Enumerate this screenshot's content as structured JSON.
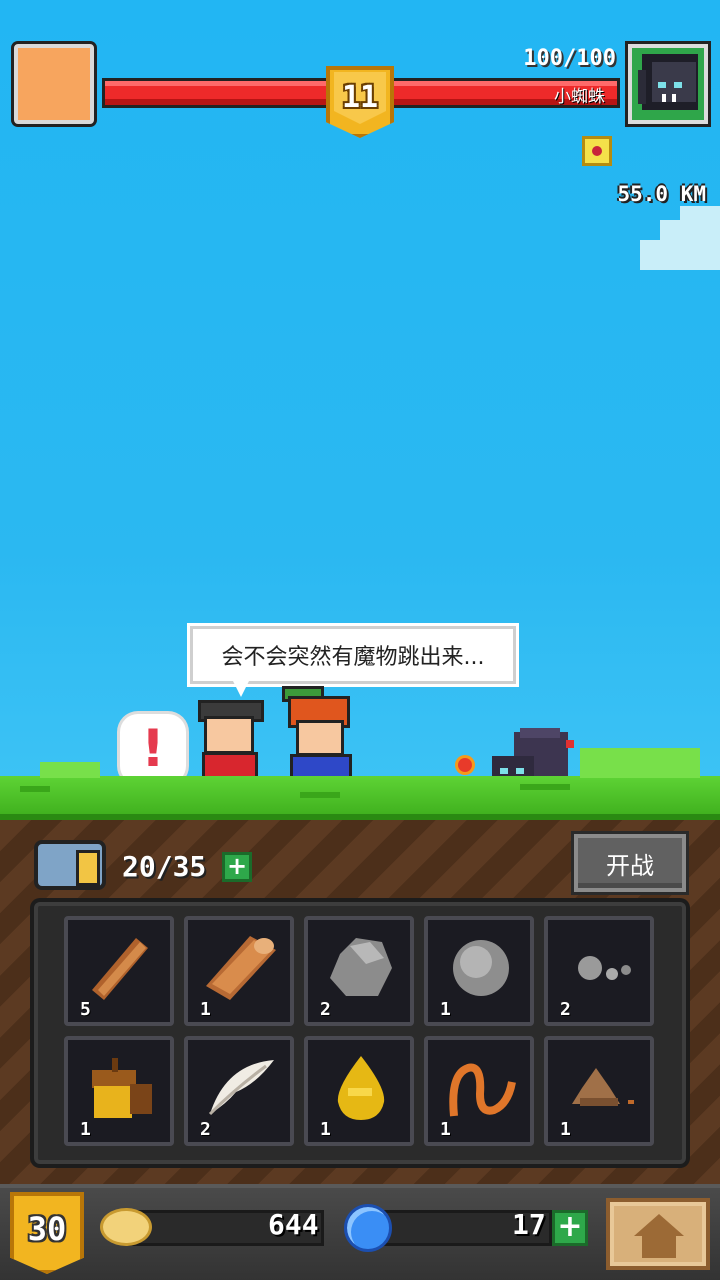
{
  "hud": {
    "player_hp_text": "100/100",
    "enemy_name": "小蜘蛛",
    "stage_level": "11",
    "distance": "55.0 KM",
    "enemy_hp_fraction": 1.0
  },
  "scene": {
    "speech_text": "会不会突然有魔物跳出来...",
    "alert_symbol": "!"
  },
  "bag": {
    "count": "20/35",
    "add_symbol": "+",
    "battle_label": "开战"
  },
  "inventory": [
    {
      "item": "wood-stick",
      "qty": "5"
    },
    {
      "item": "wood-log",
      "qty": "1"
    },
    {
      "item": "stone",
      "qty": "2"
    },
    {
      "item": "round-stone",
      "qty": "1"
    },
    {
      "item": "pebbles",
      "qty": "2"
    },
    {
      "item": "acorn",
      "qty": "1"
    },
    {
      "item": "feather",
      "qty": "2"
    },
    {
      "item": "honey-drop",
      "qty": "1"
    },
    {
      "item": "worm",
      "qty": "1"
    },
    {
      "item": "dung-pile",
      "qty": "1"
    }
  ],
  "bottom": {
    "player_level": "30",
    "coins": "644",
    "gems": "17",
    "gem_add": "+"
  },
  "colors": {
    "sky": "#22b6f3",
    "hp_red": "#ee2a2a",
    "gold": "#f2b520",
    "grass": "#5ed335"
  }
}
